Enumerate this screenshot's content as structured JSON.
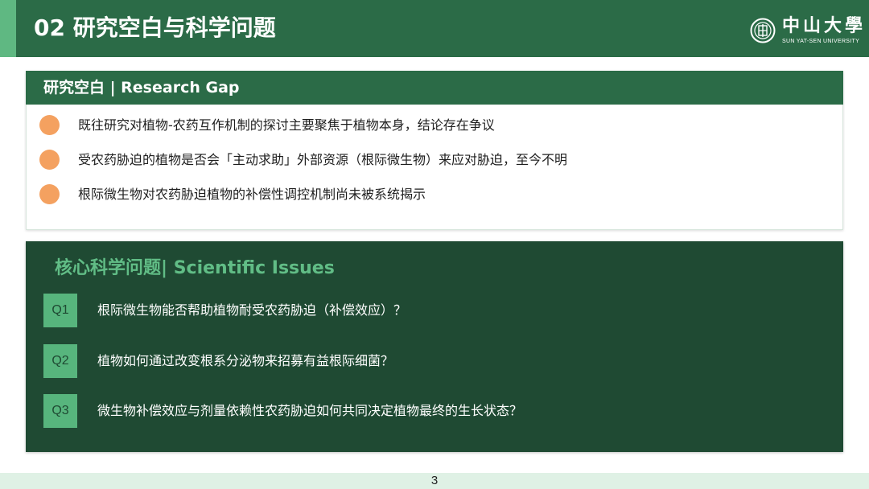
{
  "header": {
    "title": "02  研究空白与科学问题",
    "logo": {
      "name_cn": "中山大學",
      "name_en": "SUN YAT-SEN UNIVERSITY",
      "icon": "university-emblem-icon"
    }
  },
  "research_gap": {
    "heading": "研究空白 | Research Gap",
    "items": [
      "既往研究对植物-农药互作机制的探讨主要聚焦于植物本身，结论存在争议",
      "受农药胁迫的植物是否会「主动求助」外部资源（根际微生物）来应对胁迫，至今不明",
      "根际微生物对农药胁迫植物的补偿性调控机制尚未被系统揭示"
    ],
    "bullet_color": "#f4a160"
  },
  "scientific_issues": {
    "heading": "核心科学问题| Scientific Issues",
    "questions": [
      {
        "badge": "Q1",
        "text": "根际微生物能否帮助植物耐受农药胁迫（补偿效应）？"
      },
      {
        "badge": "Q2",
        "text": "植物如何通过改变根系分泌物来招募有益根际细菌？"
      },
      {
        "badge": "Q3",
        "text": "微生物补偿效应与剂量依赖性农药胁迫如何共同决定植物最终的生长状态？"
      }
    ]
  },
  "footer": {
    "page_number": "3"
  },
  "colors": {
    "primary_green": "#2b6b47",
    "dark_green": "#1f4a33",
    "accent_green": "#57b57d",
    "orange": "#f4a160"
  }
}
